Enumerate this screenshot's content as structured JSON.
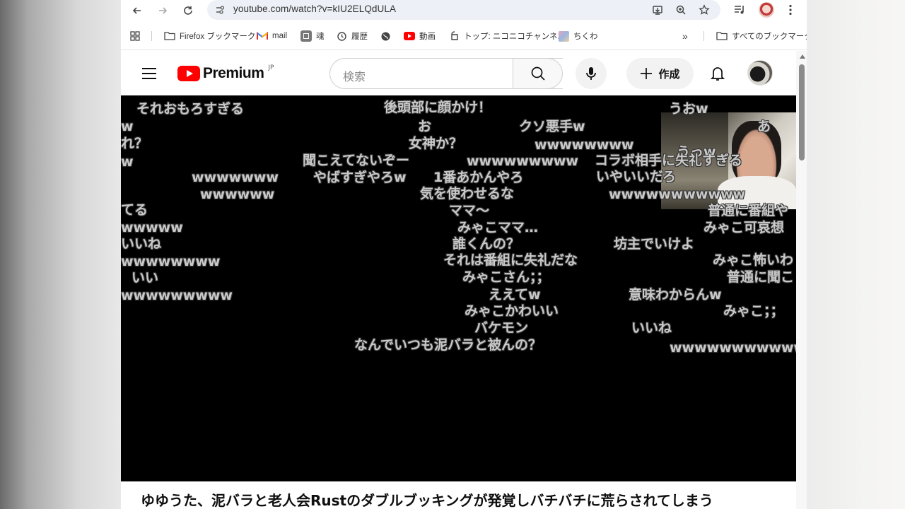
{
  "browser": {
    "url": "youtube.com/watch?v=kIU2ELQdULA",
    "bookmarks": [
      {
        "label": "Firefox ブックマーク",
        "icon": "folder-icon"
      },
      {
        "label": "mail",
        "icon": "gmail-icon"
      },
      {
        "label": "魂",
        "icon": "bookmark-icon"
      },
      {
        "label": "履歴",
        "icon": "history-icon"
      },
      {
        "label": "",
        "icon": "globe-icon"
      },
      {
        "label": "動画",
        "icon": "youtube-icon"
      },
      {
        "label": "トップ: ニコニコチャンネ...",
        "icon": "niconico-icon"
      },
      {
        "label": "ちくわ",
        "icon": "image-icon"
      }
    ],
    "all_bookmarks_label": "すべてのブックマーク"
  },
  "youtube": {
    "logo_text": "Premium",
    "region": "JP",
    "search_placeholder": "検索",
    "create_label": "作成",
    "brand_color": "#ff0000"
  },
  "video": {
    "title": "ゆゆうた、泥バラと老人会Rustのダブルブッキングが発覚しバチバチに荒らされてしまう",
    "comments": [
      "それおもろすぎる",
      "後頭部に顔かけ！",
      "うおw",
      "w",
      "お",
      "クソ悪手w",
      "あ",
      "れ？",
      "女神か？",
      "wwwwwwww",
      "うっw",
      "聞こえてないぞー",
      "wwwwwwwww",
      "コラボ相手に失礼すぎる",
      "w",
      "wwwwwww",
      "やばすぎやろw",
      "1番あかんやろ",
      "いやいいだろ",
      "wwwwww",
      "気を使わせるな",
      "wwwwwwwwwww",
      "てる",
      "ママ～",
      "普通に番組や",
      "wwwww",
      "みゃこママ…",
      "みゃこ可哀想",
      "いいね",
      "誰くんの？",
      "坊主でいけよ",
      "wwwwwwww",
      "それは番組に失礼だな",
      "みゃこ怖いわ",
      "いい",
      "みゃこさん；；",
      "普通に聞こ",
      "wwwwwwwww",
      "ええてw",
      "意味わからんw",
      "みゃこかわいい",
      "みゃこ；；",
      "バケモン",
      "いいね",
      "なんでいつも泥バラと被んの？",
      "wwwwwwwwwwwww"
    ]
  }
}
